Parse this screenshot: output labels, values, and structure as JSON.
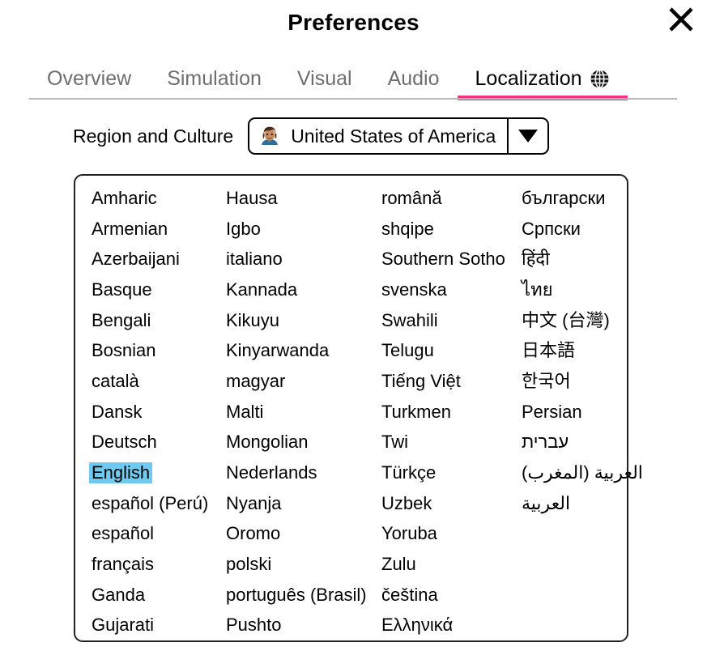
{
  "window": {
    "title": "Preferences",
    "close_icon": "close-icon"
  },
  "tabs": [
    {
      "label": "Overview",
      "active": false
    },
    {
      "label": "Simulation",
      "active": false
    },
    {
      "label": "Visual",
      "active": false
    },
    {
      "label": "Audio",
      "active": false
    },
    {
      "label": "Localization",
      "active": true,
      "icon": "globe-icon"
    }
  ],
  "region": {
    "label": "Region and Culture",
    "value": "United States of America",
    "avatar_icon": "person-avatar-icon",
    "caret_icon": "chevron-down-icon"
  },
  "language_list": {
    "selected": "English",
    "highlight_color": "#6ecbef",
    "columns": [
      {
        "rtl": false,
        "items": [
          "Amharic",
          "Armenian",
          "Azerbaijani",
          "Basque",
          "Bengali",
          "Bosnian",
          "català",
          "Dansk",
          "Deutsch",
          "English",
          "español (Perú)",
          "español",
          "français",
          "Ganda",
          "Gujarati"
        ]
      },
      {
        "rtl": false,
        "items": [
          "Hausa",
          "Igbo",
          "italiano",
          "Kannada",
          "Kikuyu",
          "Kinyarwanda",
          "magyar",
          "Malti",
          "Mongolian",
          "Nederlands",
          "Nyanja",
          "Oromo",
          "polski",
          "português (Brasil)",
          "Pushto"
        ]
      },
      {
        "rtl": false,
        "items": [
          "română",
          "shqipe",
          "Southern Sotho",
          "svenska",
          "Swahili",
          "Telugu",
          "Tiếng Việt",
          "Turkmen",
          "Twi",
          "Türkçe",
          "Uzbek",
          "Yoruba",
          "Zulu",
          "čeština",
          "Ελληνικά"
        ]
      },
      {
        "rtl": false,
        "items": [
          "български",
          "Српски",
          "हिंदी",
          "ไทย",
          "中文 (台灣)",
          "日本語",
          "한국어",
          "Persian",
          "עברית",
          "العربية (المغرب)",
          "العربية"
        ],
        "rtl_from_index": 8
      }
    ]
  },
  "colors": {
    "accent": "#f7317f",
    "tab_inactive": "#6e6e6e",
    "separator": "#b9b9b9",
    "selection": "#6ecbef"
  }
}
